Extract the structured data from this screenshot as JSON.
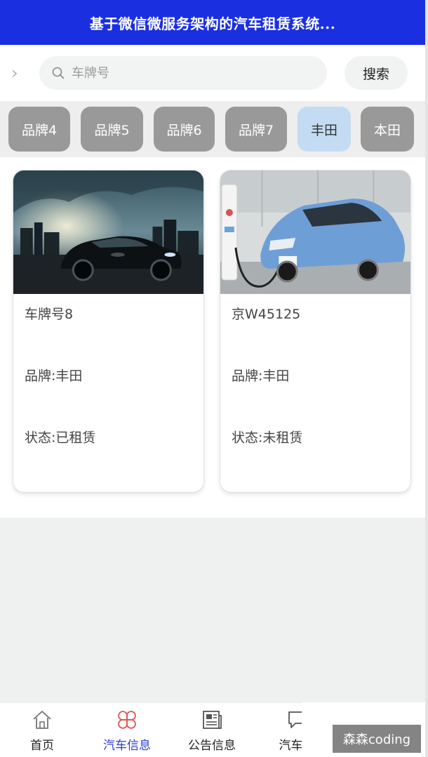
{
  "header": {
    "title": "基于微信微服务架构的汽车租赁系统..."
  },
  "search": {
    "placeholder": "车牌号",
    "value": "",
    "button_label": "搜索"
  },
  "brands": [
    {
      "label": "品牌4",
      "active": false
    },
    {
      "label": "品牌5",
      "active": false
    },
    {
      "label": "品牌6",
      "active": false
    },
    {
      "label": "品牌7",
      "active": false
    },
    {
      "label": "丰田",
      "active": true
    },
    {
      "label": "本田",
      "active": false
    }
  ],
  "cars": [
    {
      "plate": "车牌号8",
      "brand": "品牌:丰田",
      "status": "状态:已租赁",
      "image": "dark-sports-sedan"
    },
    {
      "plate": "京W45125",
      "brand": "品牌:丰田",
      "status": "状态:未租赁",
      "image": "blue-electric-car-charging"
    }
  ],
  "tabbar": {
    "items": [
      {
        "label": "首页",
        "icon": "home-icon",
        "active": false
      },
      {
        "label": "汽车信息",
        "icon": "grid-flower-icon",
        "active": true
      },
      {
        "label": "公告信息",
        "icon": "news-icon",
        "active": false
      },
      {
        "label": "汽车评",
        "icon": "chat-icon",
        "active": false
      }
    ]
  },
  "watermark": {
    "text": "森森coding"
  },
  "colors": {
    "header": "#1a2fe0",
    "chip": "#999999",
    "chip_active": "#c3dcf3",
    "tab_active": "#2a3fd0",
    "tab_active_icon": "#e0524f"
  }
}
